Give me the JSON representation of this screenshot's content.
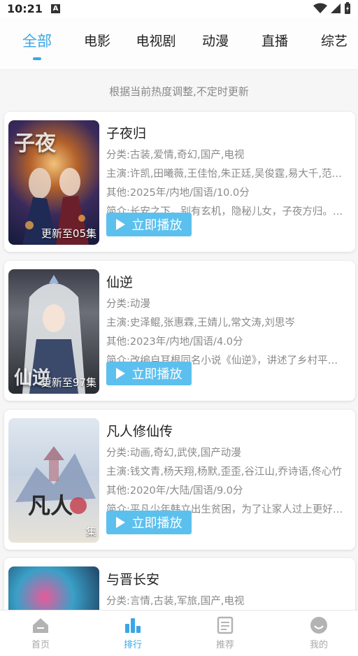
{
  "status_bar": {
    "time": "10:21",
    "notif_letter": "A"
  },
  "tabs": [
    {
      "label": "全部",
      "active": true
    },
    {
      "label": "电影",
      "active": false
    },
    {
      "label": "电视剧",
      "active": false
    },
    {
      "label": "动漫",
      "active": false
    },
    {
      "label": "直播",
      "active": false
    },
    {
      "label": "综艺",
      "active": false
    }
  ],
  "notice": "根据当前热度调整,不定时更新",
  "play_label": "立即播放",
  "items": [
    {
      "title": "子夜归",
      "category": "分类:古装,爱情,奇幻,国产,电视",
      "cast": "主演:许凯,田曦薇,王佳怡,朱正廷,吴俊霆,易大千,范…",
      "other": "其他:2025年/内地/国语/10.0分",
      "intro": "简介:长安之下，别有玄机，隐秘儿女，子夜方归。…",
      "badge": "更新至05集",
      "poster_glyph": "子夜"
    },
    {
      "title": "仙逆",
      "category": "分类:动漫",
      "cast": "主演:史泽鲲,张惠霖,王婧儿,常文涛,刘思岑",
      "other": "其他:2023年/内地/国语/4.0分",
      "intro": "简介:改编自耳根同名小说《仙逆》，讲述了乡村平…",
      "badge": "更新至97集",
      "poster_glyph": "仙逆"
    },
    {
      "title": "凡人修仙传",
      "category": "分类:动画,奇幻,武侠,国产动漫",
      "cast": "主演:钱文青,杨天翔,杨默,歪歪,谷江山,乔诗语,佟心竹",
      "other": "其他:2020年/大陆/国语/9.0分",
      "intro": "简介:平凡少年韩立出生贫困，为了让家人过上更好…",
      "badge": "集",
      "poster_glyph": "凡人"
    },
    {
      "title": "与晋长安",
      "category": "分类:言情,古装,军旅,国产,电视",
      "cast": "",
      "other": "",
      "intro": "",
      "badge": "",
      "poster_glyph": ""
    }
  ],
  "bottom_nav": [
    {
      "label": "首页",
      "icon": "home-icon",
      "active": false
    },
    {
      "label": "排行",
      "icon": "ranking-icon",
      "active": true
    },
    {
      "label": "推荐",
      "icon": "recommend-icon",
      "active": false
    },
    {
      "label": "我的",
      "icon": "profile-icon",
      "active": false
    }
  ],
  "colors": {
    "accent": "#3aa6e6",
    "play_button": "#5cc0ee"
  }
}
